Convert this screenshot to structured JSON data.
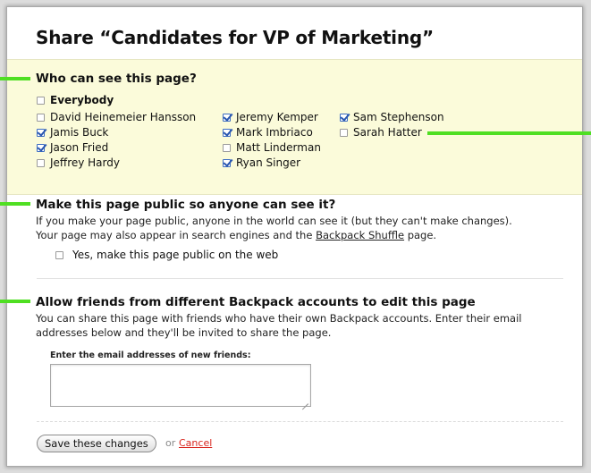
{
  "page_title": "Share “Candidates for VP of Marketing”",
  "who_section": {
    "heading": "Who can see this page?",
    "everybody": {
      "label": "Everybody",
      "checked": false
    },
    "people": [
      {
        "name": "David Heinemeier Hansson",
        "checked": false
      },
      {
        "name": "Jamis Buck",
        "checked": true
      },
      {
        "name": "Jason Fried",
        "checked": true
      },
      {
        "name": "Jeffrey Hardy",
        "checked": false
      },
      {
        "name": "Jeremy Kemper",
        "checked": true
      },
      {
        "name": "Mark Imbriaco",
        "checked": true
      },
      {
        "name": "Matt Linderman",
        "checked": false
      },
      {
        "name": "Ryan Singer",
        "checked": true
      },
      {
        "name": "Sam Stephenson",
        "checked": true
      },
      {
        "name": "Sarah Hatter",
        "checked": false
      }
    ]
  },
  "public_section": {
    "heading": "Make this page public so anyone can see it?",
    "line1": "If you make your page public, anyone in the world can see it (but they can't make changes).",
    "line2_prefix": "Your page may also appear in search engines and the ",
    "shuffle_link": "Backpack Shuffle",
    "line2_suffix": " page.",
    "checkbox_label": "Yes, make this page public on the web",
    "checked": false
  },
  "friends_section": {
    "heading": "Allow friends from different Backpack accounts to edit this page",
    "line1": "You can share this page with friends who have their own Backpack accounts. Enter their email",
    "line2": "addresses below and they'll be invited to share the page.",
    "email_label": "Enter the email addresses of new friends:",
    "email_value": ""
  },
  "actions": {
    "save_label": "Save these changes",
    "or_text": "or",
    "cancel_label": "Cancel"
  },
  "colors": {
    "marker_green": "#4fdf22",
    "panel_yellow": "#fbfbda",
    "cancel_red": "#d8261f",
    "checkbox_blue": "#2a57b0"
  }
}
